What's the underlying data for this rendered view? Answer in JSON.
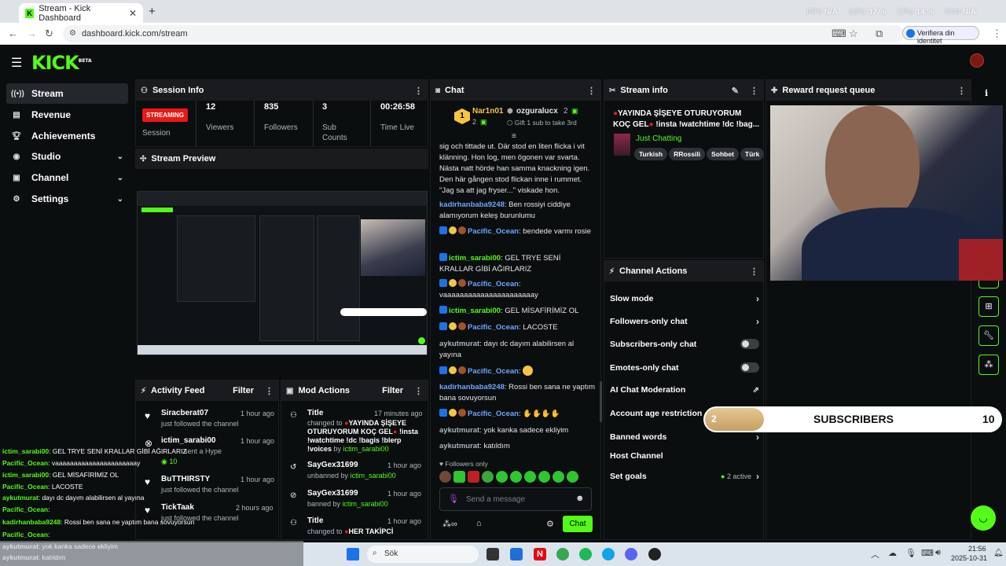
{
  "browser": {
    "tab_title": "Stream - Kick Dashboard",
    "url": "dashboard.kick.com/stream",
    "verify_label": "Verifiera din identitet",
    "sysmon": [
      {
        "label": "FPS",
        "value": "N/A"
      },
      {
        "label": "GPU",
        "value": "37 %"
      },
      {
        "label": "CPU",
        "value": "14 %"
      },
      {
        "label": "FAN",
        "value": "N/A"
      }
    ]
  },
  "brand": {
    "logo": "KICK",
    "beta": "BETA",
    "accent": "#53fc18"
  },
  "sidebar": {
    "items": [
      {
        "label": "Stream",
        "icon": "broadcast-icon",
        "active": true
      },
      {
        "label": "Revenue",
        "icon": "revenue-icon"
      },
      {
        "label": "Achievements",
        "icon": "trophy-icon"
      },
      {
        "label": "Studio",
        "icon": "studio-icon"
      },
      {
        "label": "Channel",
        "icon": "channel-icon"
      },
      {
        "label": "Settings",
        "icon": "gear-icon"
      }
    ]
  },
  "session": {
    "title": "Session Info",
    "status": "STREAMING",
    "status_label": "Session",
    "viewers": "12",
    "viewers_label": "Viewers",
    "followers": "835",
    "followers_label": "Followers",
    "subs": "3",
    "subs_label": "Sub Counts",
    "time": "00:26:58",
    "time_label": "Time Live"
  },
  "preview": {
    "title": "Stream Preview"
  },
  "activity": {
    "title": "Activity Feed",
    "filter": "Filter",
    "items": [
      {
        "name": "Siracberat07",
        "text": "just followed the channel",
        "time": "1 hour ago"
      },
      {
        "name": "ictim_sarabi00",
        "text": "sent a Hype",
        "time": "1 hour ago",
        "extra": "10"
      },
      {
        "name": "BuTTHIRSTY",
        "text": "just followed the channel",
        "time": "1 hour ago"
      },
      {
        "name": "TickTaak",
        "text": "just followed the channel",
        "time": "2 hours ago"
      }
    ]
  },
  "mod": {
    "title": "Mod Actions",
    "filter": "Filter",
    "items": [
      {
        "name": "Title",
        "pre": "changed to",
        "text": "YAYINDA ŞİŞEYE OTURUYORUM KOÇ GEL",
        "text2": "!insta !watchtime !dc !bagis !blerp !voices",
        "by_label": "by",
        "by": "ictim_sarabi00",
        "time": "17 minutes ago"
      },
      {
        "name": "SayGex31699",
        "pre": "unbanned by",
        "by": "ictim_sarabi00",
        "time": "1 hour ago"
      },
      {
        "name": "SayGex31699",
        "pre": "banned by",
        "by": "ictim_sarabi00",
        "time": "1 hour ago"
      },
      {
        "name": "Title",
        "pre": "changed to",
        "text": "HER TAKİPCİ",
        "time": "1 hour ago"
      }
    ]
  },
  "chat": {
    "title": "Chat",
    "top1": {
      "rank": "1",
      "name": "Nar1n01",
      "count": "2"
    },
    "top2": {
      "name": "ozguralucx",
      "count": "2",
      "sub": "Gift 1 sub to take 3rd"
    },
    "messages": [
      {
        "text": "sig och tittade ut. Där stod en liten flicka i vit klänning. Hon log, men ögonen var svarta. Nästa natt hörde han samma knackning igen. Den här gången stod flickan inne i rummet. \"Jag sa att jag fryser...\" viskade hon."
      },
      {
        "user": "kadirhanbaba9248",
        "text": ": Ben rossiyi ciddiye alamıyorum keleş burunlumu",
        "color": "blue"
      },
      {
        "user": "Pacific_Ocean",
        "text": ": bendede varmı rosie",
        "color": "blue",
        "badges": true
      },
      {
        "user": "ictim_sarabi00",
        "text": ": GEL TRYE SENİ KRALLAR GİBİ AĞIRLARIZ",
        "color": "green",
        "badges": true
      },
      {
        "user": "Pacific_Ocean",
        "text": ": vaaaaaaaaaaaaaaaaaaaaaay",
        "color": "blue",
        "badges": true
      },
      {
        "user": "ictim_sarabi00",
        "text": ": GEL MİSAFİRİMİZ OL",
        "color": "green",
        "badges": true
      },
      {
        "user": "Pacific_Ocean",
        "text": ": LACOSTE",
        "color": "blue",
        "badges": true
      },
      {
        "user": "aykutmurat",
        "text": ": dayı dc dayım alabilirsen al yayına",
        "color": "gray"
      },
      {
        "user": "Pacific_Ocean",
        "text": ":",
        "color": "blue",
        "badges": true
      },
      {
        "user": "kadirhanbaba9248",
        "text": ": Rossi ben sana ne yaptım bana sovuyorsun",
        "color": "blue"
      },
      {
        "user": "Pacific_Ocean",
        "text": ":",
        "color": "blue",
        "badges": true
      },
      {
        "user": "aykutmurat",
        "text": ": yok kanka sadece ekliyim",
        "color": "gray"
      },
      {
        "user": "aykutmurat",
        "text": ": katıldım",
        "color": "gray"
      }
    ],
    "followers_only": "Followers only",
    "placeholder": "Send a message",
    "send": "Chat"
  },
  "stream_info": {
    "title": "Stream info",
    "stream_title": "YAYINDA ŞİŞEYE OTURUYORUM KOÇ GEL",
    "stream_title2": "!insta !watchtime !dc !bag...",
    "category": "Just Chatting",
    "tags": [
      "Turkish",
      "RRossili",
      "Sohbet",
      "Türk"
    ]
  },
  "channel_actions": {
    "title": "Channel Actions",
    "items": [
      {
        "label": "Slow mode",
        "control": "chevron"
      },
      {
        "label": "Followers-only chat",
        "control": "chevron"
      },
      {
        "label": "Subscribers-only chat",
        "control": "toggle"
      },
      {
        "label": "Emotes-only chat",
        "control": "toggle"
      },
      {
        "label": "AI Chat Moderation",
        "control": "external"
      },
      {
        "label": "Account age restriction",
        "control": "none"
      },
      {
        "label": "Banned words",
        "control": "chevron"
      },
      {
        "label": "Host Channel",
        "control": "none"
      },
      {
        "label": "Set goals",
        "control": "active",
        "value": "2 active"
      }
    ]
  },
  "reward": {
    "title": "Reward request queue"
  },
  "sub_goal": {
    "label": "SUBSCRIBERS",
    "current": "2",
    "target": "10",
    "progress": 0.2
  },
  "overlay_chat": [
    {
      "user": "ictim_sarabi00",
      "text": ": GEL TRYE SENİ KRALLAR GİBİ AĞIRLARIZ"
    },
    {
      "user": "Pacific_Ocean",
      "text": ": vaaaaaaaaaaaaaaaaaaaaaay"
    },
    {
      "user": "ictim_sarabi00",
      "text": ": GEL MİSAFİRİMİZ OL"
    },
    {
      "user": "Pacific_Ocean",
      "text": ": LACOSTE"
    },
    {
      "user": "aykutmurat",
      "text": ": dayı dc dayım alabilirsen al yayına"
    },
    {
      "user": "Pacific_Ocean",
      "text": ":"
    },
    {
      "user": "kadirhanbaba9248",
      "text": ": Rossi ben sana ne yaptım bana sovuyorsun"
    },
    {
      "user": "Pacific_Ocean",
      "text": ":"
    },
    {
      "user": "aykutmurat",
      "text": ": yok kanka sadece ekliyim"
    },
    {
      "user": "aykutmurat",
      "text": ": katıldım"
    }
  ],
  "taskbar": {
    "search": "Sök",
    "time": "21:56",
    "date": "2025-10-31"
  }
}
